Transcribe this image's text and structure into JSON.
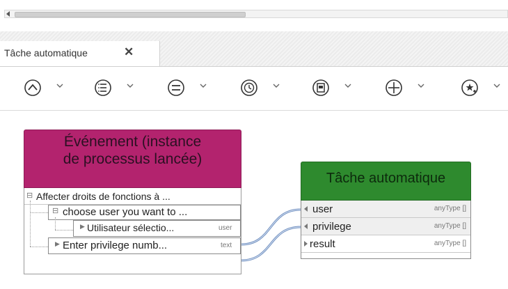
{
  "tab": {
    "title": "Tâche automatique",
    "close_glyph": "✕"
  },
  "toolbar": {
    "tools": [
      {
        "icon": "circle-caret-up-icon"
      },
      {
        "icon": "circle-list-icon"
      },
      {
        "icon": "circle-equals-icon"
      },
      {
        "icon": "circle-clock-icon"
      },
      {
        "icon": "circle-document-icon"
      },
      {
        "icon": "circle-plus-icon"
      },
      {
        "icon": "circle-star-add-icon"
      }
    ]
  },
  "event": {
    "title_line1": "Événement (instance",
    "title_line2": "de processus lancée)",
    "root_label": "Affecter droits de fonctions à ...",
    "child_label": "choose user you want to ...",
    "param1_label": "Utilisateur sélectio...",
    "param1_type": "user",
    "param2_label": "Enter privilege numb...",
    "param2_type": "text",
    "color": "#b3236e"
  },
  "task": {
    "title": "Tâche automatique",
    "color": "#2e8a2e",
    "rows": [
      {
        "name": "user",
        "type": "anyType []"
      },
      {
        "name": "privilege",
        "type": "anyType []"
      },
      {
        "name": "result",
        "type": "anyType []"
      }
    ]
  }
}
